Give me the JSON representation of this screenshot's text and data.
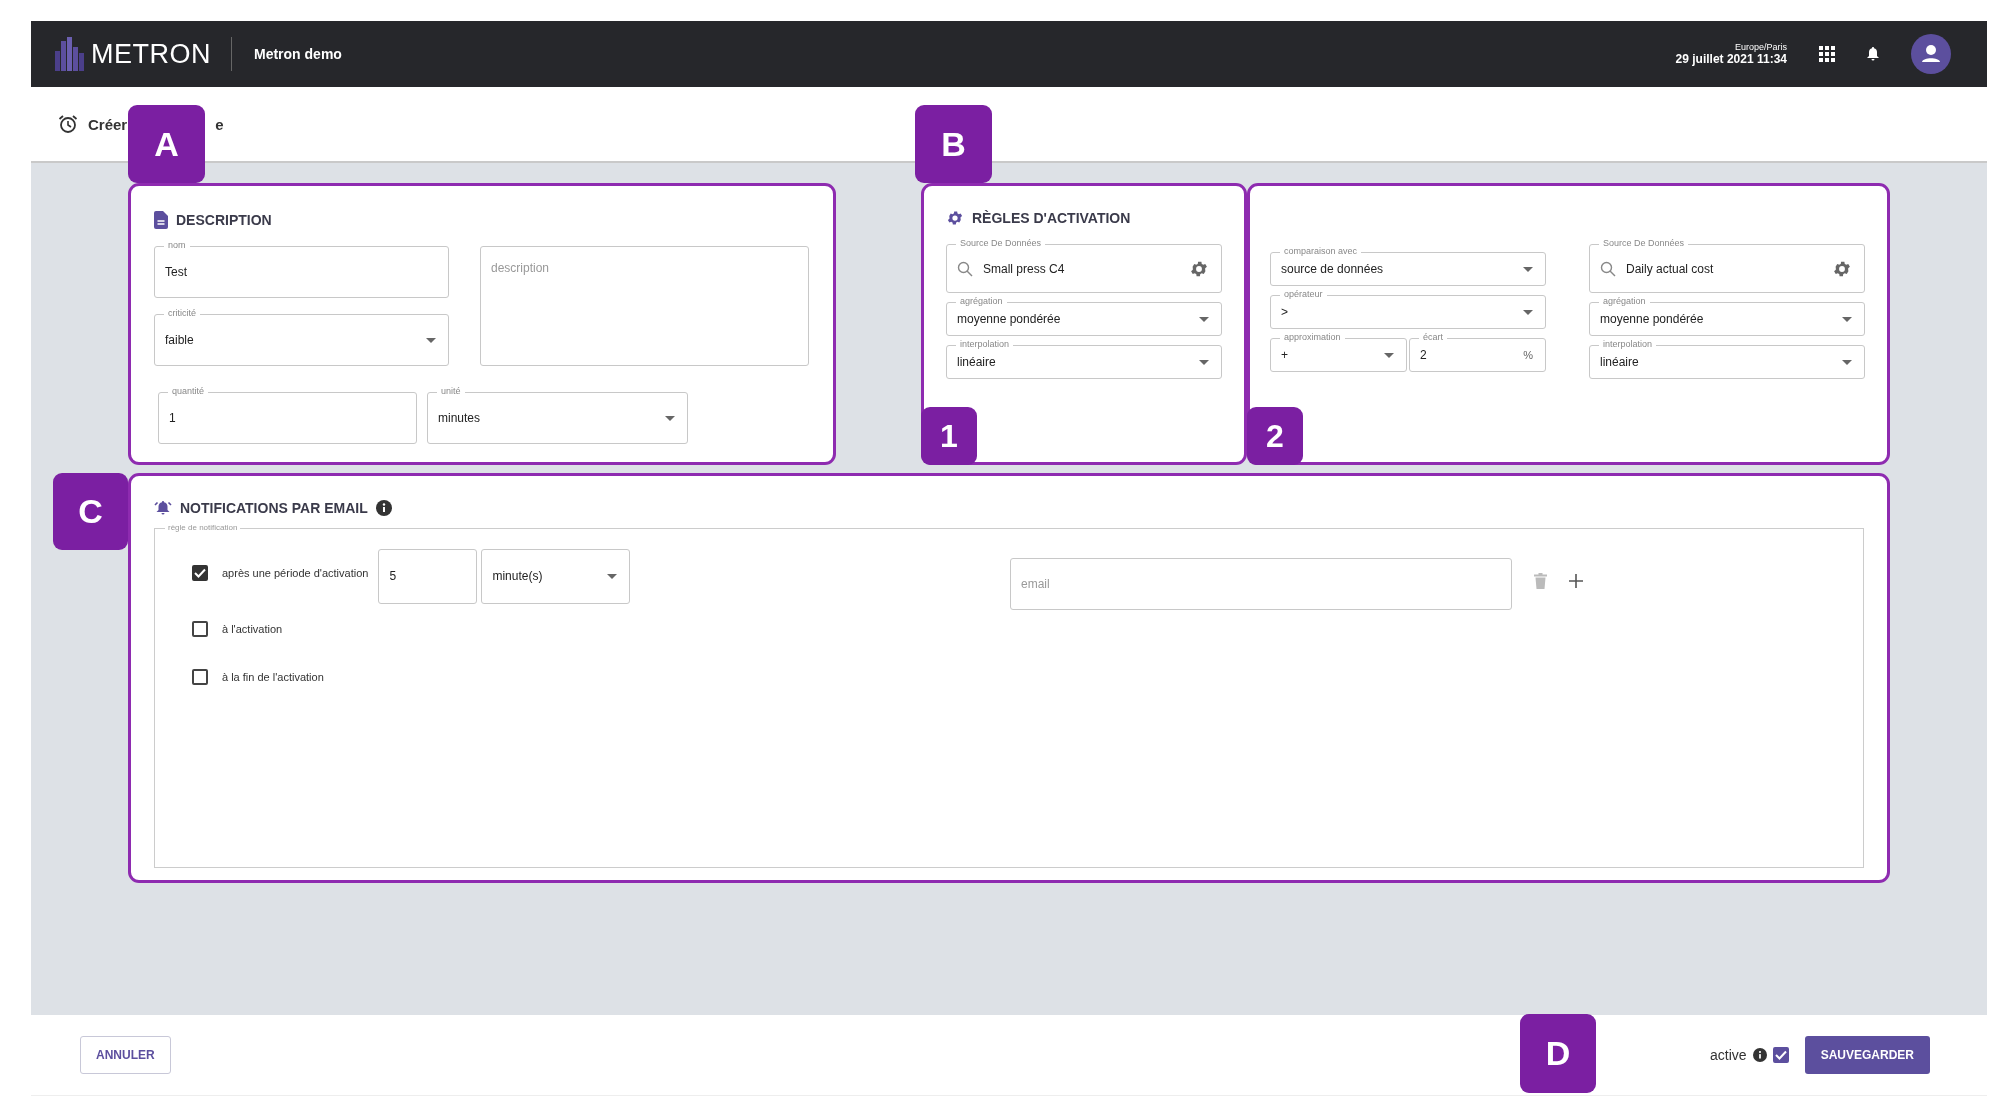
{
  "header": {
    "logo": "METRON",
    "app_name": "Metron demo",
    "timezone": "Europe/Paris",
    "datetime": "29 juillet 2021 11:34"
  },
  "page_title": {
    "visible_start": "Créer",
    "visible_end": "e"
  },
  "description": {
    "callout": "A",
    "title": "DESCRIPTION",
    "name": {
      "kind": "text",
      "label": "nom",
      "value": "Test"
    },
    "criticality": {
      "kind": "select",
      "label": "criticité",
      "value": "faible"
    },
    "description": {
      "kind": "textarea",
      "placeholder": "description"
    },
    "quantity": {
      "kind": "text",
      "label": "quantité",
      "value": "1"
    },
    "unit": {
      "kind": "select",
      "label": "unité",
      "value": "minutes"
    }
  },
  "activation_rules": {
    "callout": "B",
    "title": "RÈGLES D'ACTIVATION",
    "source": {
      "callout": "1",
      "fields": [
        {
          "kind": "search",
          "label": "Source De Données",
          "value": "Small press C4"
        },
        {
          "kind": "select",
          "label": "agrégation",
          "value": "moyenne pondérée"
        },
        {
          "kind": "select",
          "label": "interpolation",
          "value": "linéaire"
        }
      ]
    },
    "comparison": {
      "callout": "2",
      "compare_with": {
        "kind": "select",
        "label": "comparaison avec",
        "value": "source de données"
      },
      "operator": {
        "kind": "select",
        "label": "opérateur",
        "value": ">"
      },
      "approximation": {
        "kind": "select",
        "label": "approximation",
        "value": "+"
      },
      "gap": {
        "kind": "text",
        "label": "écart",
        "value": "2",
        "suffix": "%"
      },
      "target_fields": [
        {
          "kind": "search",
          "label": "Source De Données",
          "value": "Daily actual cost"
        },
        {
          "kind": "select",
          "label": "agrégation",
          "value": "moyenne pondérée"
        },
        {
          "kind": "select",
          "label": "interpolation",
          "value": "linéaire"
        }
      ]
    }
  },
  "notifications": {
    "callout": "C",
    "title": "NOTIFICATIONS PAR EMAIL",
    "group_label": "règle de notification",
    "rules": [
      {
        "label": "après une période d'activation",
        "checked": true,
        "duration": {
          "kind": "text",
          "value": "5"
        },
        "unit": {
          "kind": "select",
          "value": "minute(s)"
        }
      },
      {
        "label": "à l'activation",
        "checked": false
      },
      {
        "label": "à la fin de l'activation",
        "checked": false
      }
    ],
    "email": {
      "kind": "text",
      "placeholder": "email"
    }
  },
  "footer": {
    "cancel": "ANNULER",
    "callout": "D",
    "active": {
      "label": "active",
      "checked": true
    },
    "save": "SAUVEGARDER"
  }
}
